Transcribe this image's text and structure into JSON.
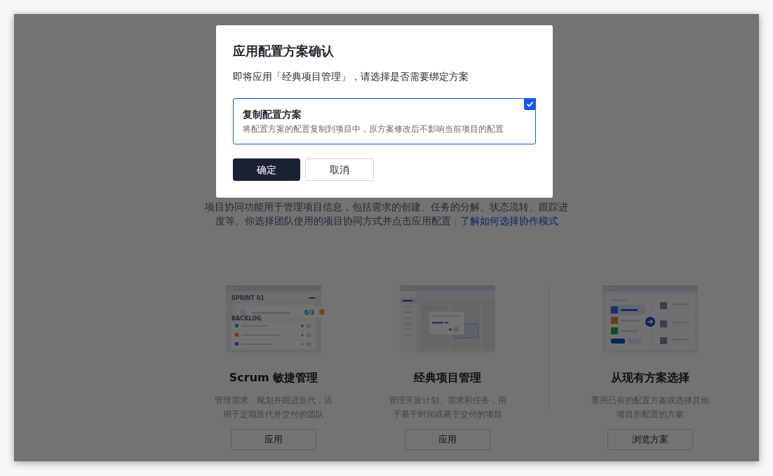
{
  "page": {
    "description": "项目协同功能用于管理项目信息，包括需求的创建、任务的分解、状态流转、跟踪进度等。你选择团队使用的项目协同方式并点击应用配置",
    "link": "了解如何选择协作模式"
  },
  "cards": [
    {
      "kind": "scrum",
      "title": "Scrum 敏捷管理",
      "description": "管理需求、规划并跟进迭代，适用于定期迭代并交付的团队",
      "button": "应用",
      "labels": [
        "SPRINT 01",
        "BACKLOG",
        "0/3"
      ]
    },
    {
      "kind": "classic",
      "title": "经典项目管理",
      "description": "管理开发计划、需求和任务，用于基于时间或基于交付的项目",
      "button": "应用"
    },
    {
      "kind": "existing",
      "title": "从现有方案选择",
      "description": "重用已有的配置方案或选择其他项目所配置的方案",
      "button": "浏览方案"
    }
  ],
  "dialog": {
    "title": "应用配置方案确认",
    "message": "即将应用「经典项目管理」，请选择是否需要绑定方案",
    "option": {
      "title": "复制配置方案",
      "description": "将配置方案的配置复制到项目中，原方案修改后不影响当前项目的配置",
      "selected": true
    },
    "buttons": [
      {
        "kind": "primary",
        "label": "确定"
      },
      {
        "kind": "secondary",
        "label": "取消"
      }
    ]
  }
}
